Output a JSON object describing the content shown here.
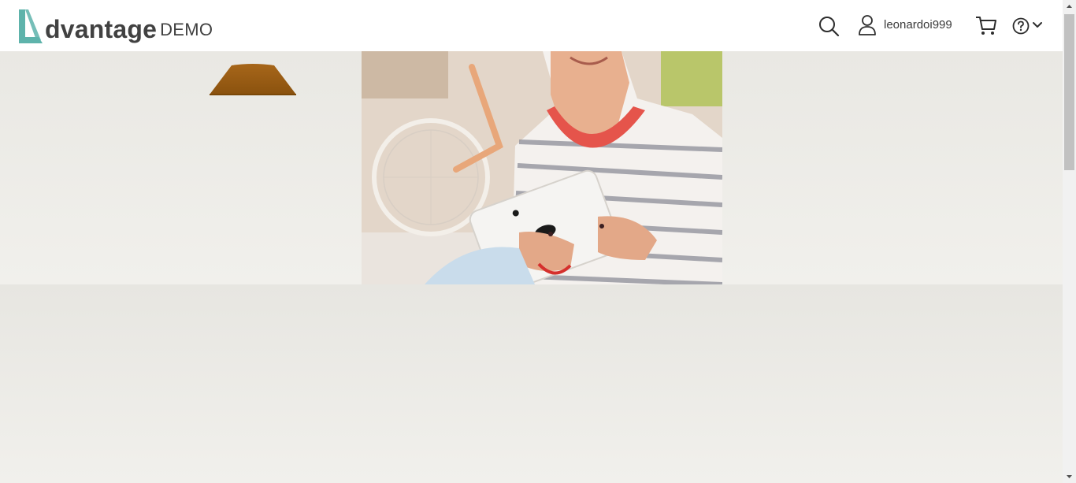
{
  "header": {
    "logo": {
      "word": "dvantage",
      "demo": "DEMO"
    },
    "user": {
      "name": "leonardoi999"
    },
    "icons": [
      "search-icon",
      "user-icon",
      "cart-icon",
      "help-icon",
      "chevron-down-icon"
    ]
  },
  "hero": {
    "photo": "woman holding a white tablet in front of a bicycle",
    "accent_colors": {
      "lamp": "#9a5a12",
      "logo_teal": "#5eb3ab",
      "background": "#ecebe7"
    }
  }
}
